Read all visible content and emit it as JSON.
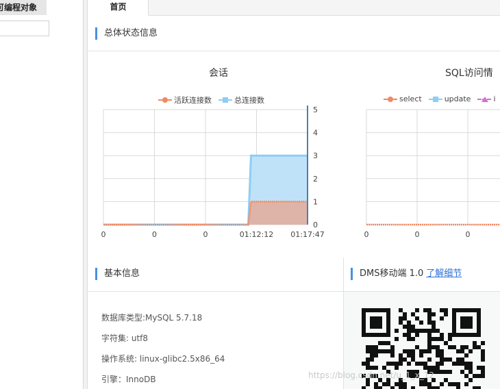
{
  "sidebar": {
    "tab_label": "可编程对象",
    "search_value": ""
  },
  "tabs": [
    {
      "label": "首页"
    }
  ],
  "overview": {
    "title": "总体状态信息"
  },
  "charts": {
    "session": {
      "title": "会话",
      "legend": [
        "活跃连接数",
        "总连接数"
      ],
      "x_ticks": [
        "0",
        "0",
        "0",
        "01:12:12",
        "01:17:47"
      ],
      "y_ticks": [
        "5",
        "4",
        "3",
        "2",
        "1",
        "0"
      ]
    },
    "sql": {
      "title": "SQL访问情",
      "legend": [
        "select",
        "update",
        "i"
      ],
      "x_ticks": [
        "0",
        "0",
        "0"
      ]
    }
  },
  "chart_data": [
    {
      "type": "area",
      "title": "会话",
      "categories": [
        "0",
        "0",
        "0",
        "01:12:12",
        "01:17:47"
      ],
      "series": [
        {
          "name": "活跃连接数",
          "color": "#f08860",
          "values": [
            0,
            0,
            0,
            1,
            1
          ]
        },
        {
          "name": "总连接数",
          "color": "#8ecdf5",
          "values": [
            0,
            0,
            0,
            3,
            3
          ]
        }
      ],
      "ylim": [
        0,
        5
      ],
      "y_axis_position": "right",
      "grid": true,
      "legend_position": "top"
    },
    {
      "type": "line",
      "title": "SQL访问情",
      "categories": [
        "0",
        "0",
        "0"
      ],
      "series": [
        {
          "name": "select",
          "color": "#f08860",
          "values": [
            0,
            0,
            0
          ]
        },
        {
          "name": "update",
          "color": "#8ecdf5",
          "values": [
            0,
            0,
            0
          ]
        },
        {
          "name": "i",
          "color": "#d070d0",
          "values": [
            0,
            0,
            0
          ]
        }
      ],
      "grid": true,
      "legend_position": "top"
    }
  ],
  "basic_info": {
    "title": "基本信息",
    "db_type": "数据库类型:MySQL 5.7.18",
    "charset": "字符集: utf8",
    "os": "操作系统: linux-glibc2.5x86_64",
    "engine": "引擎：InnoDB"
  },
  "dms": {
    "title": "DMS移动端 1.0",
    "link": "了解细节"
  },
  "watermark": "https://blog.csdn.net/u_1_x_12",
  "colors": {
    "accent": "#4a8fe0",
    "orange": "#f08860",
    "blue": "#8ecdf5",
    "purple": "#d070d0",
    "link": "#2a6fd6"
  }
}
